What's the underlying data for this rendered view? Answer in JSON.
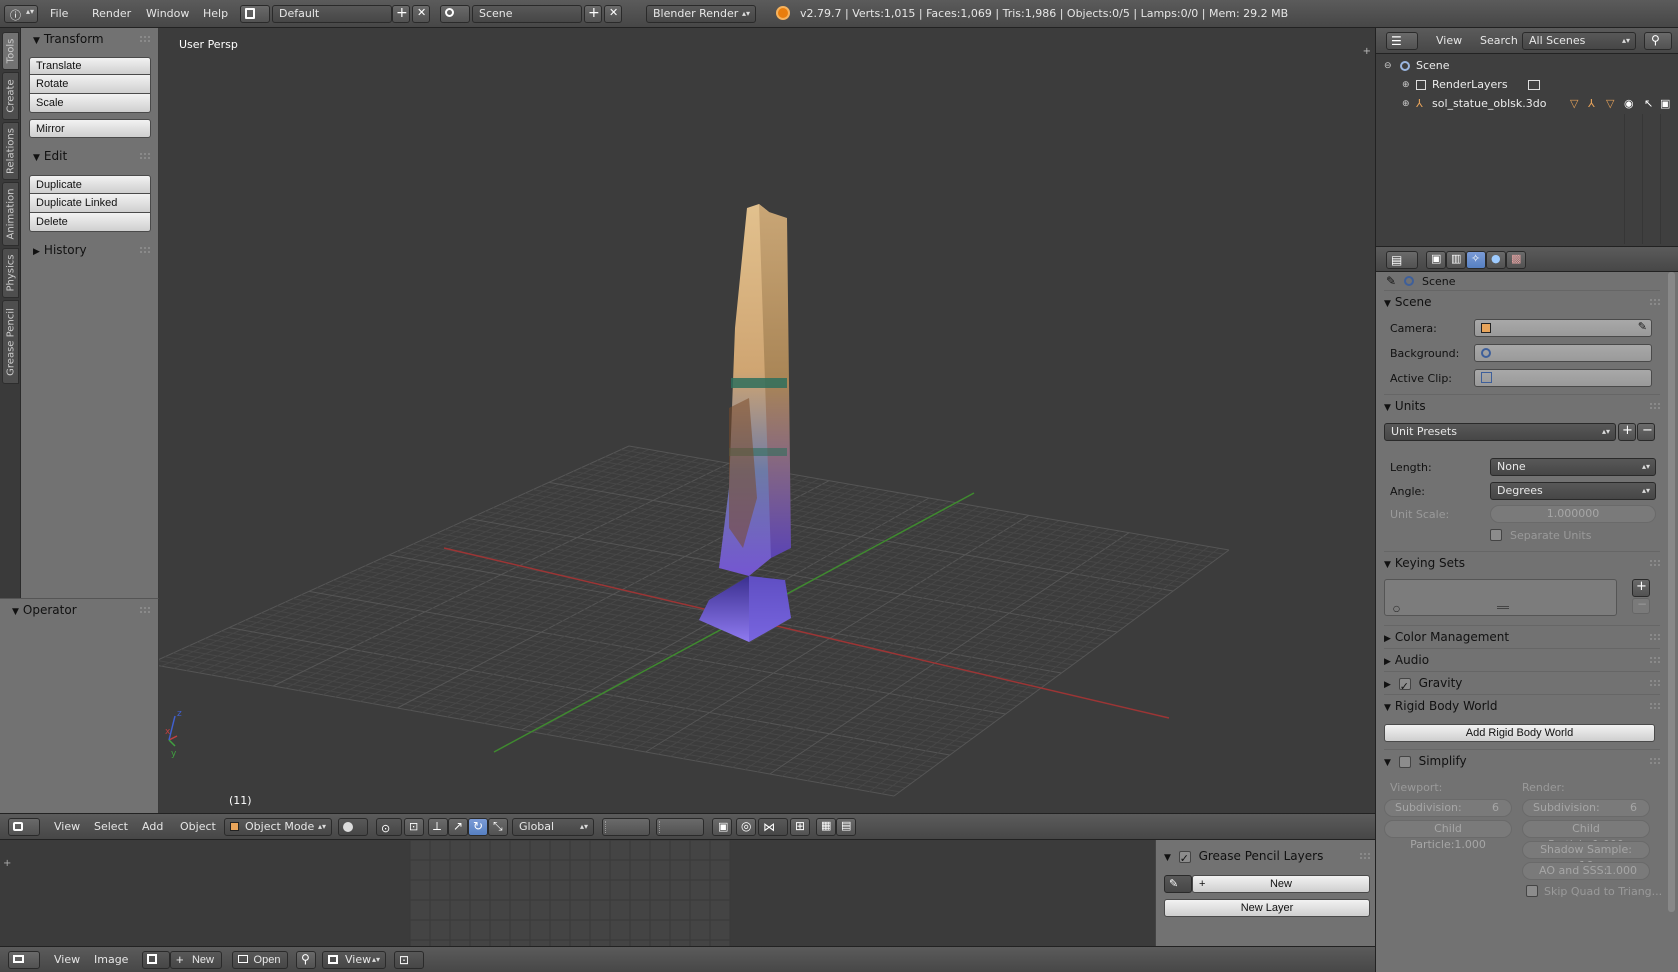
{
  "info_header": {
    "menus": [
      "File",
      "Render",
      "Window",
      "Help"
    ],
    "layout_name": "Default",
    "scene_name": "Scene",
    "render_engine": "Blender Render",
    "stats": "v2.79.7 | Verts:1,015 | Faces:1,069 | Tris:1,986 | Objects:0/5 | Lamps:0/0 | Mem: 29.2 MB"
  },
  "side_tabs": [
    "Tools",
    "Create",
    "Relations",
    "Animation",
    "Physics",
    "Grease Pencil"
  ],
  "tool_shelf": {
    "transform": {
      "title": "Transform",
      "buttons": [
        "Translate",
        "Rotate",
        "Scale"
      ],
      "mirror": "Mirror"
    },
    "edit": {
      "title": "Edit",
      "buttons": [
        "Duplicate",
        "Duplicate Linked",
        "Delete"
      ]
    },
    "history": {
      "title": "History"
    },
    "operator": {
      "title": "Operator"
    }
  },
  "viewport": {
    "view_label": "User Persp",
    "frame_label": "(11)"
  },
  "view3d_header": {
    "menus": [
      "View",
      "Select",
      "Add",
      "Object"
    ],
    "mode": "Object Mode",
    "orientation": "Global"
  },
  "image_editor_header": {
    "menus": [
      "View",
      "Image"
    ],
    "new_label": "New",
    "open_label": "Open",
    "view_label": "View"
  },
  "grease_pencil": {
    "title": "Grease Pencil Layers",
    "new_label": "New",
    "new_layer_label": "New Layer"
  },
  "outliner": {
    "menus": [
      "View",
      "Search"
    ],
    "filter": "All Scenes",
    "items": [
      {
        "label": "Scene"
      },
      {
        "label": "RenderLayers"
      },
      {
        "label": "sol_statue_oblsk.3do"
      }
    ]
  },
  "properties": {
    "breadcrumb": "Scene",
    "scene_section": {
      "title": "Scene",
      "camera_label": "Camera:",
      "background_label": "Background:",
      "active_clip_label": "Active Clip:"
    },
    "units": {
      "title": "Units",
      "presets": "Unit Presets",
      "length_label": "Length:",
      "length_value": "None",
      "angle_label": "Angle:",
      "angle_value": "Degrees",
      "unit_scale_label": "Unit Scale:",
      "unit_scale_value": "1.000000",
      "separate_units": "Separate Units"
    },
    "keying_sets": {
      "title": "Keying Sets"
    },
    "collapsed_sections": [
      "Color Management",
      "Audio"
    ],
    "gravity": {
      "title": "Gravity",
      "checked": true
    },
    "rigid_body": {
      "title": "Rigid Body World",
      "button": "Add Rigid Body World"
    },
    "simplify": {
      "title": "Simplify",
      "viewport_label": "Viewport:",
      "render_label": "Render:",
      "vp_subdivision": "Subdivision:",
      "vp_subdivision_value": "6",
      "vp_child_particle": "Child Particle:1.000",
      "r_subdivision": "Subdivision:",
      "r_subdivision_value": "6",
      "r_child_particle": "Child Particle:1.000",
      "r_shadow_sample": "Shadow Sample: 16",
      "r_ao_sss": "AO and SSS:",
      "r_ao_sss_value": "1.000",
      "skip_quad": "Skip Quad to Triang..."
    }
  },
  "colors": {
    "viewport_bg": "#3c3c3c",
    "panel_bg": "#727272",
    "header_bg": "#4f4f4f",
    "x_axis": "#9c3535",
    "y_axis": "#3f8a2f",
    "highlight": "#5680c2"
  }
}
